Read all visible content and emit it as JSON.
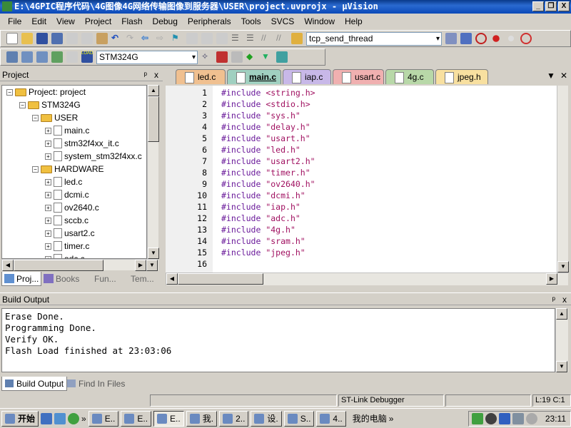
{
  "window": {
    "title": "E:\\4GPIC程序代码\\4G图像4G网络传输图像到服务器\\USER\\project.uvprojx - µVision"
  },
  "menu": [
    "File",
    "Edit",
    "View",
    "Project",
    "Flash",
    "Debug",
    "Peripherals",
    "Tools",
    "SVCS",
    "Window",
    "Help"
  ],
  "toolbar": {
    "find_combo": "tcp_send_thread",
    "target_combo": "STM324G"
  },
  "project_panel": {
    "title": "Project",
    "root": "Project: project",
    "target": "STM324G",
    "groups": [
      {
        "name": "USER",
        "files": [
          "main.c",
          "stm32f4xx_it.c",
          "system_stm32f4xx.c"
        ]
      },
      {
        "name": "HARDWARE",
        "files": [
          "led.c",
          "dcmi.c",
          "ov2640.c",
          "sccb.c",
          "usart2.c",
          "timer.c",
          "adc.c"
        ]
      }
    ],
    "tabs": [
      "Proj...",
      "Books",
      "Fun...",
      "Tem..."
    ]
  },
  "editor": {
    "tabs": [
      {
        "label": "led.c",
        "color": "#f0c090"
      },
      {
        "label": "main.c",
        "color": "#a0d0c0",
        "active": true
      },
      {
        "label": "iap.c",
        "color": "#c8b8e8"
      },
      {
        "label": "usart.c",
        "color": "#f0b0b0"
      },
      {
        "label": "4g.c",
        "color": "#b8d8a8"
      },
      {
        "label": "jpeg.h",
        "color": "#f8e0a0"
      }
    ],
    "lines": [
      {
        "n": "1",
        "kw": "#include",
        "arg": "<string.h>"
      },
      {
        "n": "2",
        "kw": "#include",
        "arg": "<stdio.h>"
      },
      {
        "n": "3",
        "kw": "#include",
        "arg": "\"sys.h\""
      },
      {
        "n": "4",
        "kw": "#include",
        "arg": "\"delay.h\""
      },
      {
        "n": "5",
        "kw": "#include",
        "arg": "\"usart.h\""
      },
      {
        "n": "6",
        "kw": "#include",
        "arg": "\"led.h\""
      },
      {
        "n": "7",
        "kw": "#include",
        "arg": "\"usart2.h\""
      },
      {
        "n": "8",
        "kw": "#include",
        "arg": "\"timer.h\""
      },
      {
        "n": "9",
        "kw": "#include",
        "arg": "\"ov2640.h\""
      },
      {
        "n": "10",
        "kw": "#include",
        "arg": "\"dcmi.h\""
      },
      {
        "n": "11",
        "kw": "#include",
        "arg": "\"iap.h\""
      },
      {
        "n": "12",
        "kw": "#include",
        "arg": "\"adc.h\""
      },
      {
        "n": "13",
        "kw": "#include",
        "arg": "\"4g.h\""
      },
      {
        "n": "14",
        "kw": "#include",
        "arg": "\"sram.h\""
      },
      {
        "n": "15",
        "kw": "#include",
        "arg": "\"jpeg.h\""
      },
      {
        "n": "16",
        "kw": "",
        "arg": ""
      }
    ]
  },
  "build_output": {
    "title": "Build Output",
    "lines": [
      "Erase Done.",
      "Programming Done.",
      "Verify OK.",
      "Flash Load finished at 23:03:06"
    ],
    "tabs": [
      "Build Output",
      "Find In Files"
    ]
  },
  "status": {
    "debugger": "ST-Link Debugger",
    "position": "L:19 C:1"
  },
  "taskbar": {
    "start": "开始",
    "items": [
      "E..",
      "E..",
      "E..",
      "我.",
      "2..",
      "设.",
      "S..",
      "4.."
    ],
    "mycomputer": "我的电脑",
    "clock": "23:11"
  }
}
